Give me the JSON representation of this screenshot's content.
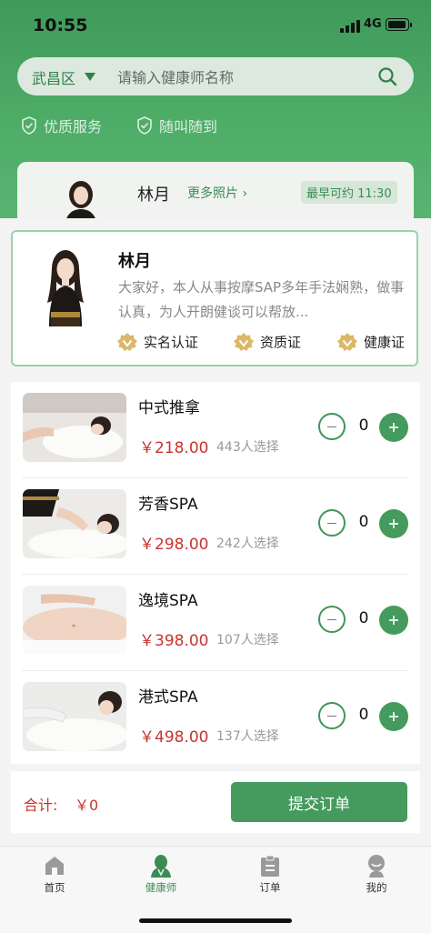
{
  "status_bar": {
    "time": "10:55",
    "network": "4G"
  },
  "search": {
    "region": "武昌区",
    "placeholder": "请输入健康师名称"
  },
  "features": [
    "优质服务",
    "随叫随到"
  ],
  "bg_card": {
    "name": "林月",
    "more_photos": "更多照片",
    "earliest": "最早可约 11:30"
  },
  "therapist": {
    "name": "林月",
    "bio": "大家好，本人从事按摩SAP多年手法娴熟，做事认真，为人开朗健谈可以帮放...",
    "badges": [
      "实名认证",
      "资质证",
      "健康证"
    ]
  },
  "services": [
    {
      "title": "中式推拿",
      "price": "￥218.00",
      "sold": "443人选择",
      "qty": "0"
    },
    {
      "title": "芳香SPA",
      "price": "￥298.00",
      "sold": "242人选择",
      "qty": "0"
    },
    {
      "title": "逸境SPA",
      "price": "￥398.00",
      "sold": "107人选择",
      "qty": "0"
    },
    {
      "title": "港式SPA",
      "price": "￥498.00",
      "sold": "137人选择",
      "qty": "0"
    }
  ],
  "summary": {
    "label": "合计:",
    "amount": "￥0",
    "submit": "提交订单"
  },
  "tabbar": [
    {
      "label": "首页",
      "icon": "home-icon"
    },
    {
      "label": "健康师",
      "icon": "therapist-icon"
    },
    {
      "label": "订单",
      "icon": "order-icon"
    },
    {
      "label": "我的",
      "icon": "profile-icon"
    }
  ],
  "colors": {
    "primary": "#459a5e",
    "price": "#c9342e",
    "border": "#9bd2ab"
  }
}
